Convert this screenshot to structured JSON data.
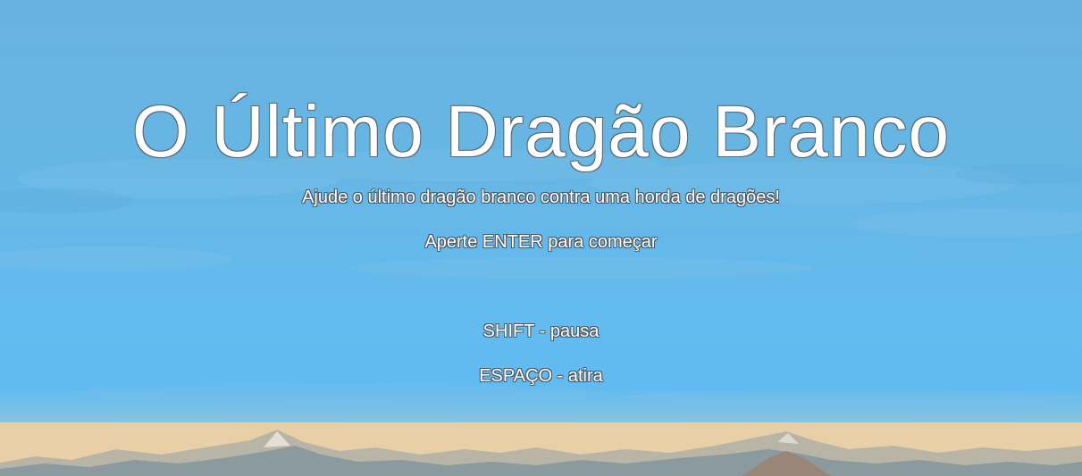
{
  "game": {
    "title": "O Último Dragão Branco",
    "subtitle": "Ajude o último dragão branco contra uma horda de dragões!",
    "start_prompt": "Aperte ENTER para começar",
    "controls": [
      "SHIFT - pausa",
      "ESPAÇO - atira"
    ]
  },
  "colors": {
    "sky_top": "#68b2df",
    "sky_bottom": "#62bbf0",
    "text": "#ffffff"
  }
}
